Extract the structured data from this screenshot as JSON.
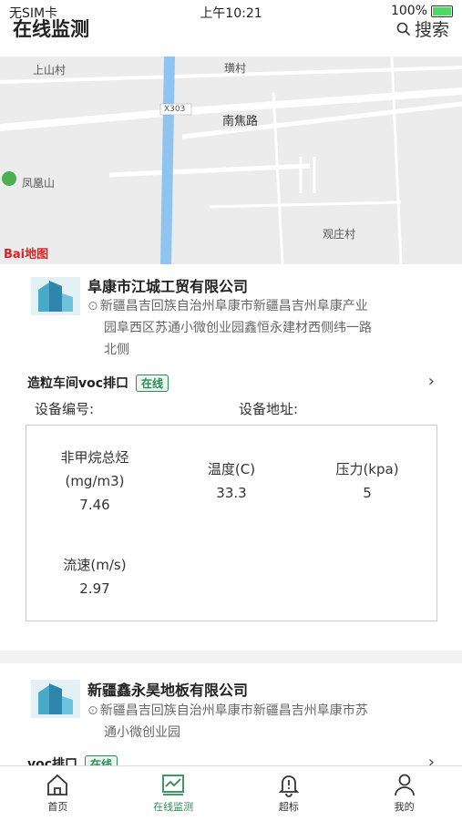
{
  "status": {
    "carrier": "无SIM卡",
    "time": "上午10:21",
    "battery": "100%"
  },
  "header": {
    "title": "在线监测",
    "search_label": "搜索"
  },
  "map": {
    "labels": [
      "上山村",
      "璜村",
      "X303",
      "南焦路",
      "凤凰山",
      "观庄村"
    ],
    "brand": "Bai地图"
  },
  "companies": [
    {
      "name": "阜康市江城工贸有限公司",
      "address_lines": [
        "新疆昌吉回族自治州阜康市新疆昌吉州阜康产业",
        "园阜西区苏通小微创业园鑫恒永建材西侧纬一路",
        "北侧"
      ],
      "device": {
        "name": "造粒车间voc排口",
        "status": "在线"
      },
      "device_no_label": "设备编号:",
      "device_addr_label": "设备地址:",
      "metrics": [
        {
          "label_lines": [
            "非甲烷总烃",
            "(mg/m3)"
          ],
          "value": "7.46"
        },
        {
          "label_lines": [
            "温度(C)"
          ],
          "value": "33.3"
        },
        {
          "label_lines": [
            "压力(kpa)"
          ],
          "value": "5"
        },
        {
          "label_lines": [
            "流速(m/s)"
          ],
          "value": "2.97"
        }
      ]
    },
    {
      "name": "新疆鑫永昊地板有限公司",
      "address_lines": [
        "新疆昌吉回族自治州阜康市新疆昌吉州阜康市苏",
        "通小微创业园"
      ],
      "device": {
        "name": "voc排口",
        "status": "在线"
      }
    }
  ],
  "tabs": [
    {
      "label": "首页",
      "icon": "home-icon"
    },
    {
      "label": "在线监测",
      "icon": "monitor-icon",
      "active": true
    },
    {
      "label": "超标",
      "icon": "bell-icon"
    },
    {
      "label": "我的",
      "icon": "user-icon"
    }
  ],
  "colors": {
    "accent": "#2e8b57",
    "map_bg": "#ececec",
    "river": "#8fc3f0"
  }
}
